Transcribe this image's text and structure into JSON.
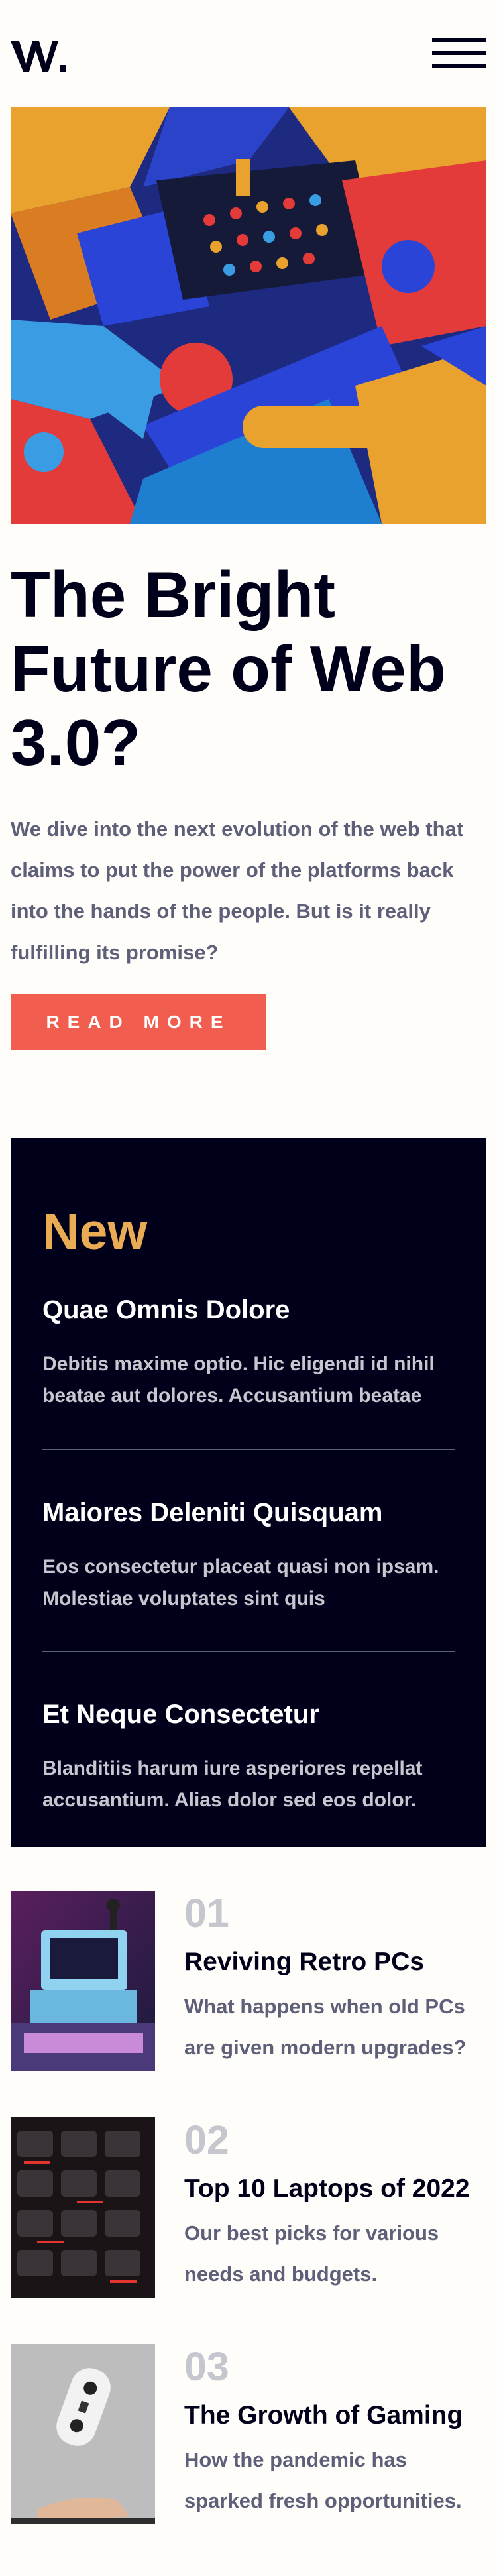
{
  "header": {
    "logo_text": "W.",
    "menu_icon": "hamburger-menu-icon"
  },
  "hero": {
    "image_alt": "Colorful 3D abstract geometric blocks",
    "title": "The Bright Future of Web 3.0?",
    "description": "We dive into the next evolution of the web that claims to put the power of the platforms back into the hands of the people. But is it really fulfilling its promise?",
    "button_label": "READ MORE"
  },
  "new_section": {
    "title": "New",
    "items": [
      {
        "title": "Quae Omnis Dolore",
        "description": "Debitis maxime optio. Hic eligendi id nihil beatae aut dolores. Accusantium beatae"
      },
      {
        "title": "Maiores Deleniti Quisquam",
        "description": "Eos consectetur placeat quasi non ipsam. Molestiae voluptates sint quis"
      },
      {
        "title": "Et Neque Consectetur",
        "description": "Blanditiis harum iure asperiores repellat accusantium. Alias dolor sed eos dolor."
      }
    ]
  },
  "articles": [
    {
      "number": "01",
      "title": "Reviving Retro PCs",
      "description": "What happens when old PCs are given modern upgrades?"
    },
    {
      "number": "02",
      "title": "Top 10 Laptops of 2022",
      "description": "Our best picks for various needs and budgets."
    },
    {
      "number": "03",
      "title": "The Growth of Gaming",
      "description": "How the pandemic has sparked fresh opportunities."
    }
  ],
  "colors": {
    "accent_red": "#f15e50",
    "accent_orange": "#e9ab53",
    "navy": "#00001a",
    "grayish_blue": "#5e607a",
    "light_gray": "#c5c6ce",
    "off_white": "#fffdfa"
  }
}
